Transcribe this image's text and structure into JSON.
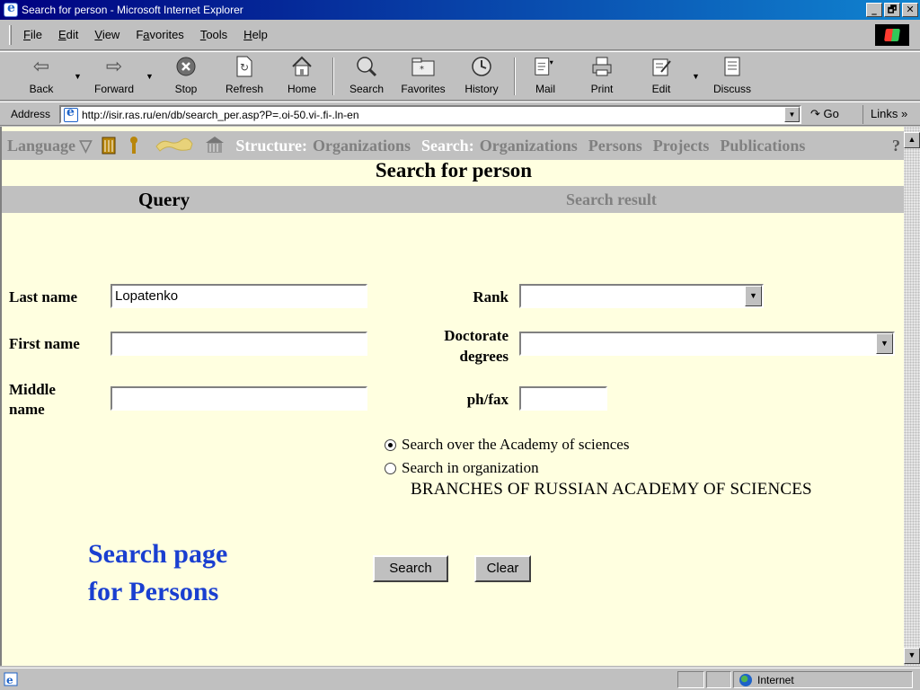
{
  "window": {
    "title": "Search for person - Microsoft Internet Explorer",
    "buttons": [
      "_",
      "🗗",
      "✕"
    ]
  },
  "menubar": {
    "items": [
      "File",
      "Edit",
      "View",
      "Favorites",
      "Tools",
      "Help"
    ],
    "accelerators": [
      "F",
      "E",
      "V",
      "a",
      "T",
      "H"
    ]
  },
  "toolbar": {
    "back": "Back",
    "forward": "Forward",
    "stop": "Stop",
    "refresh": "Refresh",
    "home": "Home",
    "search": "Search",
    "favorites": "Favorites",
    "history": "History",
    "mail": "Mail",
    "print": "Print",
    "edit": "Edit",
    "discuss": "Discuss"
  },
  "addressbar": {
    "label": "Address",
    "url": "http://isir.ras.ru/en/db/search_per.asp?P=.oi-50.vi-.fi-.ln-en",
    "go": "Go",
    "links": "Links »"
  },
  "site_nav": {
    "language": "Language ▽",
    "structure_label": "Structure:",
    "structure_organizations": "Organizations",
    "search_label": "Search:",
    "search_organizations": "Organizations",
    "persons": "Persons",
    "projects": "Projects",
    "publications": "Publications",
    "help": "?"
  },
  "page": {
    "title": "Search for person",
    "tab_query": "Query",
    "tab_result": "Search result"
  },
  "form": {
    "last_name_label": "Last name",
    "last_name_value": "Lopatenko",
    "first_name_label": "First name",
    "first_name_value": "",
    "middle_name_label": "Middle name",
    "middle_name_value": "",
    "rank_label": "Rank",
    "rank_value": "",
    "doctorate_label": "Doctorate degrees",
    "doctorate_value": "",
    "phfax_label": "ph/fax",
    "phfax_value": "",
    "radio_academy": "Search over the Academy of sciences",
    "radio_org": "Search in organization",
    "org_name": "BRANCHES OF RUSSIAN ACADEMY OF SCIENCES",
    "search_button": "Search",
    "clear_button": "Clear"
  },
  "caption": {
    "line1": "Search page",
    "line2": "for Persons"
  },
  "statusbar": {
    "zone": "Internet"
  },
  "colors": {
    "content_bg": "#ffffe0",
    "nav_bg": "#c0c0c0",
    "caption": "#1a3fd0",
    "titlebar": "#000080"
  }
}
